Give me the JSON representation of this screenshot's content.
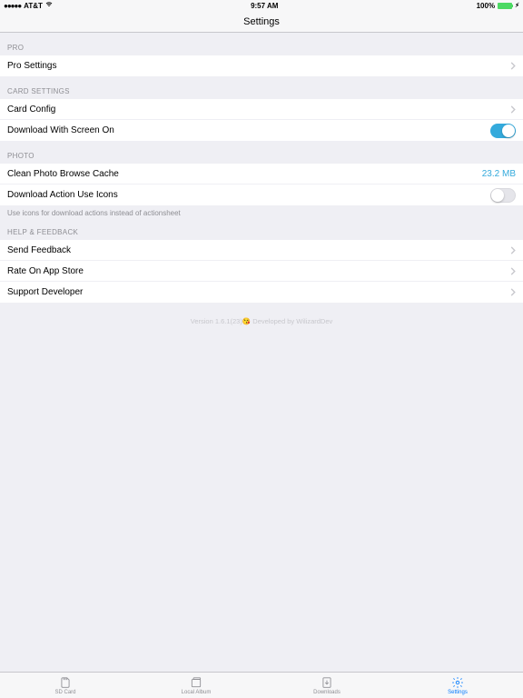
{
  "status": {
    "carrier": "AT&T",
    "time": "9:57 AM",
    "battery": "100%"
  },
  "nav": {
    "title": "Settings"
  },
  "sections": [
    {
      "header": "PRO",
      "rows": [
        {
          "key": "pro-settings",
          "label": "Pro Settings",
          "type": "nav"
        }
      ]
    },
    {
      "header": "CARD SETTINGS",
      "rows": [
        {
          "key": "card-config",
          "label": "Card Config",
          "type": "nav"
        },
        {
          "key": "download-screen-on",
          "label": "Download With Screen On",
          "type": "switch",
          "on": true
        }
      ]
    },
    {
      "header": "PHOTO",
      "rows": [
        {
          "key": "clean-cache",
          "label": "Clean Photo Browse Cache",
          "type": "detail",
          "detail": "23.2 MB"
        },
        {
          "key": "download-action-icons",
          "label": "Download Action Use Icons",
          "type": "switch",
          "on": false
        }
      ],
      "footer": "Use icons for download actions instead of actionsheet"
    },
    {
      "header": "HELP & FEEDBACK",
      "rows": [
        {
          "key": "send-feedback",
          "label": "Send Feedback",
          "type": "nav"
        },
        {
          "key": "rate",
          "label": "Rate On App Store",
          "type": "nav"
        },
        {
          "key": "support",
          "label": "Support Developer",
          "type": "nav"
        }
      ]
    }
  ],
  "version": {
    "left": "Version 1.6.1(23)",
    "right": " Developed by WilizardDev"
  },
  "tabs": [
    {
      "key": "sdcard",
      "label": "SD Card"
    },
    {
      "key": "local",
      "label": "Local Album"
    },
    {
      "key": "downloads",
      "label": "Downloads"
    },
    {
      "key": "settings",
      "label": "Settings",
      "active": true
    }
  ]
}
